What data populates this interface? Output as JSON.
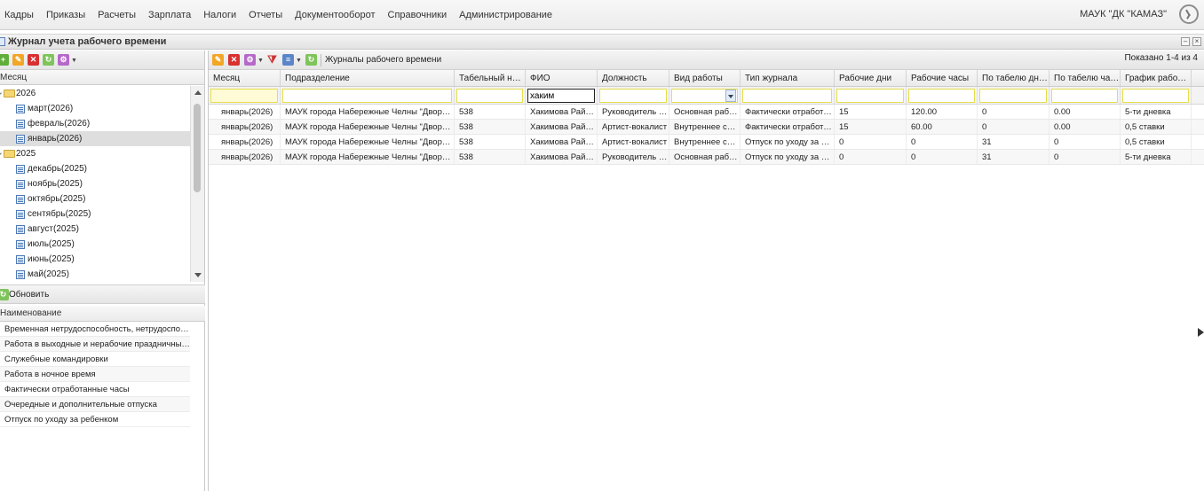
{
  "menu": {
    "items": [
      "Кадры",
      "Приказы",
      "Расчеты",
      "Зарплата",
      "Налоги",
      "Отчеты",
      "Документооборот",
      "Справочники",
      "Администрирование"
    ],
    "org": "МАУК \"ДК \"КАМАЗ\""
  },
  "window": {
    "title": "Журнал учета рабочего времени"
  },
  "left": {
    "column_header": "Месяц",
    "tree": [
      {
        "type": "year",
        "label": "2026"
      },
      {
        "type": "month",
        "label": "март(2026)"
      },
      {
        "type": "month",
        "label": "февраль(2026)"
      },
      {
        "type": "month",
        "label": "январь(2026)",
        "selected": true
      },
      {
        "type": "year",
        "label": "2025"
      },
      {
        "type": "month",
        "label": "декабрь(2025)"
      },
      {
        "type": "month",
        "label": "ноябрь(2025)"
      },
      {
        "type": "month",
        "label": "октябрь(2025)"
      },
      {
        "type": "month",
        "label": "сентябрь(2025)"
      },
      {
        "type": "month",
        "label": "август(2025)"
      },
      {
        "type": "month",
        "label": "июль(2025)"
      },
      {
        "type": "month",
        "label": "июнь(2025)"
      },
      {
        "type": "month",
        "label": "май(2025)"
      }
    ],
    "refresh_label": "Обновить",
    "name_header": "Наименование",
    "names": [
      "Временная нетрудоспособность, нетрудоспособность",
      "Работа в выходные и нерабочие праздничные дни",
      "Служебные командировки",
      "Работа в ночное время",
      "Фактически отработанные часы",
      "Очередные и дополнительные отпуска",
      "Отпуск по уходу за ребенком"
    ]
  },
  "right": {
    "toolbar_label": "Журналы рабочего времени",
    "shown": "Показано 1-4 из 4",
    "columns": [
      "Месяц",
      "Подразделение",
      "Табельный ном...",
      "ФИО",
      "Должность",
      "Вид работы",
      "Тип журнала",
      "Рабочие дни",
      "Рабочие часы",
      "По табелю дней",
      "По табелю часов",
      "График рабоче..."
    ],
    "filter_fio": "хаким",
    "rows": [
      [
        "январь(2026)",
        "МАУК города Набережные Челны \"Дворец культуры",
        "538",
        "Хакимова Райнур",
        "Руководитель кружка",
        "Основная работа",
        "Фактически отработанные",
        "15",
        "120.00",
        "0",
        "0.00",
        "5-ти дневка"
      ],
      [
        "январь(2026)",
        "МАУК города Набережные Челны \"Дворец культуры",
        "538",
        "Хакимова Райнур",
        "Артист-вокалист",
        "Внутреннее совместительство",
        "Фактически отработанные",
        "15",
        "60.00",
        "0",
        "0.00",
        "0,5 ставки"
      ],
      [
        "январь(2026)",
        "МАУК города Набережные Челны \"Дворец культуры",
        "538",
        "Хакимова Райнур",
        "Артист-вокалист",
        "Внутреннее совместительство",
        "Отпуск по уходу за ребенком",
        "0",
        "0",
        "31",
        "0",
        "0,5 ставки"
      ],
      [
        "январь(2026)",
        "МАУК города Набережные Челны \"Дворец культуры",
        "538",
        "Хакимова Райнур",
        "Руководитель кружка",
        "Основная работа",
        "Отпуск по уходу за ребенком",
        "0",
        "0",
        "31",
        "0",
        "5-ти дневка"
      ]
    ]
  }
}
